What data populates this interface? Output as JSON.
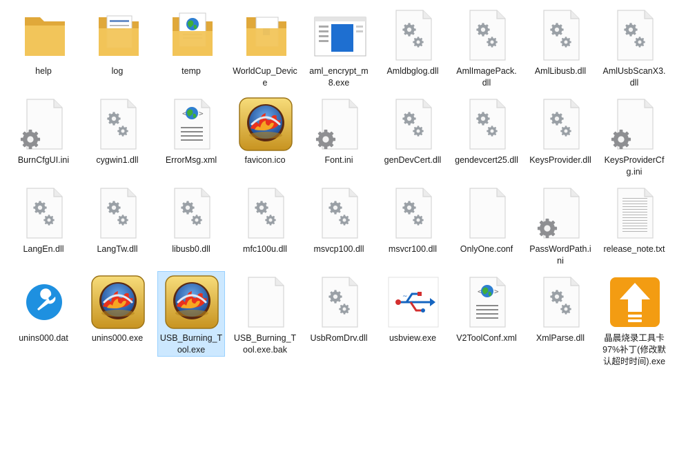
{
  "files": [
    {
      "name": "help",
      "icon": "folder-icon",
      "selected": false
    },
    {
      "name": "log",
      "icon": "folder-docs-icon",
      "selected": false
    },
    {
      "name": "temp",
      "icon": "folder-web-icon",
      "selected": false
    },
    {
      "name": "WorldCup_Device",
      "icon": "folder-image-icon",
      "selected": false
    },
    {
      "name": "aml_encrypt_m8.exe",
      "icon": "app-window-icon",
      "selected": false
    },
    {
      "name": "Amldbglog.dll",
      "icon": "dll-icon",
      "selected": false
    },
    {
      "name": "AmlImagePack.dll",
      "icon": "dll-icon",
      "selected": false
    },
    {
      "name": "AmlLibusb.dll",
      "icon": "dll-icon",
      "selected": false
    },
    {
      "name": "AmlUsbScanX3.dll",
      "icon": "dll-icon",
      "selected": false
    },
    {
      "name": "BurnCfgUI.ini",
      "icon": "ini-icon",
      "selected": false
    },
    {
      "name": "cygwin1.dll",
      "icon": "dll-icon",
      "selected": false
    },
    {
      "name": "ErrorMsg.xml",
      "icon": "xml-icon",
      "selected": false
    },
    {
      "name": "favicon.ico",
      "icon": "burner-app-icon",
      "selected": false
    },
    {
      "name": "Font.ini",
      "icon": "ini-icon",
      "selected": false
    },
    {
      "name": "genDevCert.dll",
      "icon": "dll-icon",
      "selected": false
    },
    {
      "name": "gendevcert25.dll",
      "icon": "dll-icon",
      "selected": false
    },
    {
      "name": "KeysProvider.dll",
      "icon": "dll-icon",
      "selected": false
    },
    {
      "name": "KeysProviderCfg.ini",
      "icon": "ini-icon",
      "selected": false
    },
    {
      "name": "LangEn.dll",
      "icon": "dll-icon",
      "selected": false
    },
    {
      "name": "LangTw.dll",
      "icon": "dll-icon",
      "selected": false
    },
    {
      "name": "libusb0.dll",
      "icon": "dll-icon",
      "selected": false
    },
    {
      "name": "mfc100u.dll",
      "icon": "dll-icon",
      "selected": false
    },
    {
      "name": "msvcp100.dll",
      "icon": "dll-icon",
      "selected": false
    },
    {
      "name": "msvcr100.dll",
      "icon": "dll-icon",
      "selected": false
    },
    {
      "name": "OnlyOne.conf",
      "icon": "blank-file-icon",
      "selected": false
    },
    {
      "name": "PassWordPath.ini",
      "icon": "ini-icon",
      "selected": false
    },
    {
      "name": "release_note.txt",
      "icon": "text-file-icon",
      "selected": false
    },
    {
      "name": "unins000.dat",
      "icon": "wrench-icon",
      "selected": false
    },
    {
      "name": "unins000.exe",
      "icon": "burner-app-icon",
      "selected": false
    },
    {
      "name": "USB_Burning_Tool.exe",
      "icon": "burner-app-icon",
      "selected": true
    },
    {
      "name": "USB_Burning_Tool.exe.bak",
      "icon": "blank-file-icon",
      "selected": false
    },
    {
      "name": "UsbRomDrv.dll",
      "icon": "dll-icon",
      "selected": false
    },
    {
      "name": "usbview.exe",
      "icon": "usb-icon",
      "selected": false
    },
    {
      "name": "V2ToolConf.xml",
      "icon": "xml-icon",
      "selected": false
    },
    {
      "name": "XmlParse.dll",
      "icon": "dll-icon",
      "selected": false
    },
    {
      "name": "晶晨烧录工具卡97%补丁(修改默认超时时间).exe",
      "icon": "orange-upload-icon",
      "selected": false
    }
  ],
  "colors": {
    "folder": "#f2c55a",
    "selection": "#cce8ff",
    "gear": "#9aa0a6",
    "orange": "#f39c12",
    "usb_blue": "#1565c0"
  }
}
